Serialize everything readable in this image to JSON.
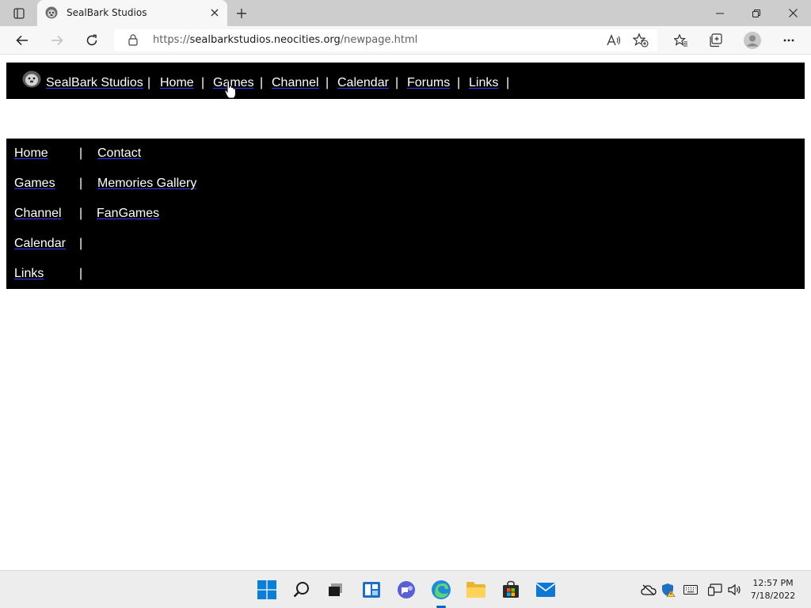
{
  "browser": {
    "tab_title": "SealBark Studios",
    "url_scheme": "https://",
    "url_host": "sealbarkstudios.neocities.org",
    "url_path": "/newpage.html"
  },
  "site": {
    "name": "SealBark Studios",
    "separator": "|",
    "nav_links": [
      "Home",
      "Games",
      "Channel",
      "Calendar",
      "Forums",
      "Links"
    ]
  },
  "sidebox": {
    "separator": "|",
    "rows": [
      {
        "left": "Home",
        "right": "Contact"
      },
      {
        "left": "Games",
        "right": "Memories Gallery"
      },
      {
        "left": "Channel",
        "right": "FanGames"
      },
      {
        "left": "Calendar",
        "right": ""
      },
      {
        "left": "Links",
        "right": ""
      }
    ]
  },
  "taskbar": {
    "time": "12:57 PM",
    "date": "7/18/2022"
  },
  "colors": {
    "nav_bg": "#000000",
    "link_text": "#ffffff",
    "link_underline": "#3a3aff",
    "taskbar_bg": "#ededed",
    "accent": "#0067c0"
  }
}
